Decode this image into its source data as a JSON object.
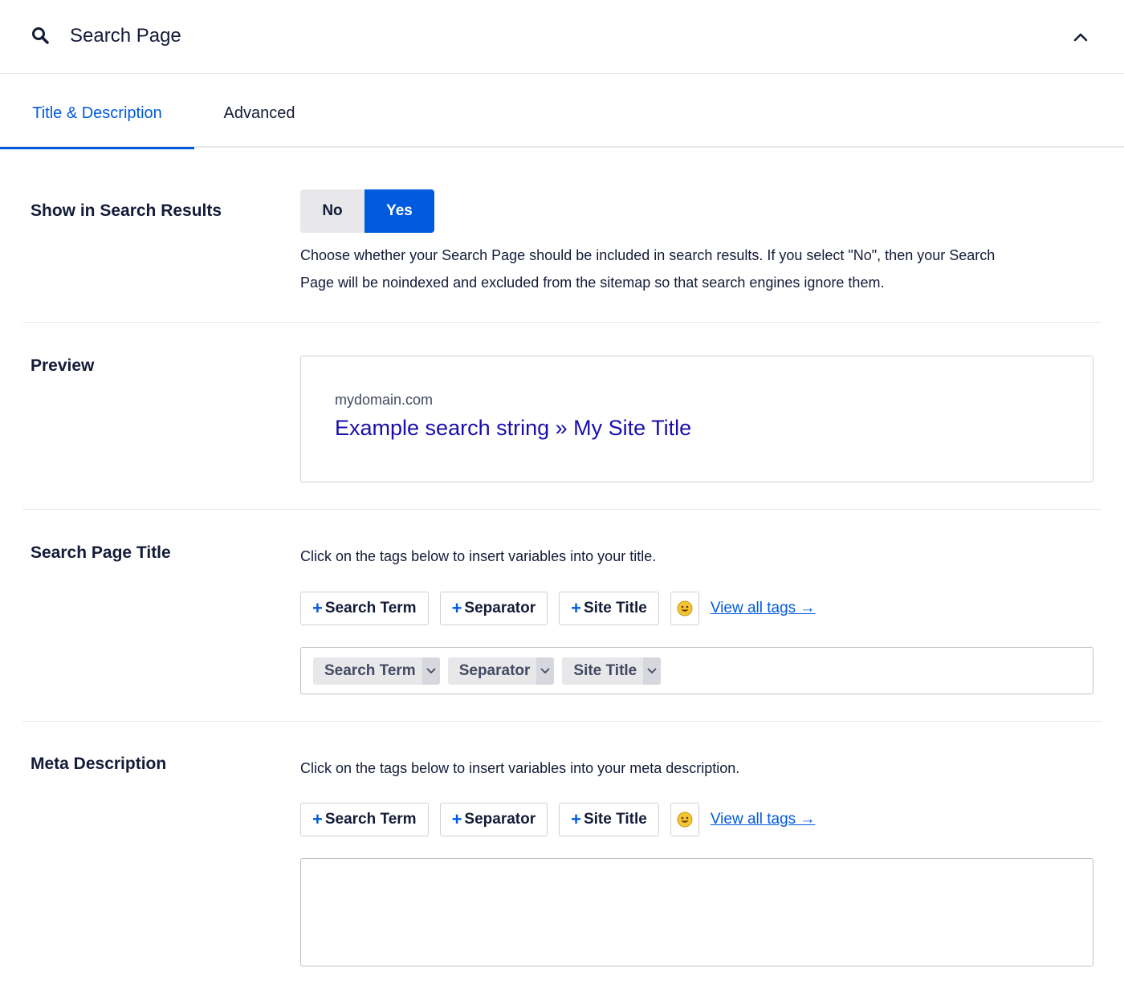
{
  "header": {
    "title": "Search Page",
    "icon": "search-icon",
    "toggle_icon": "chevron-up-icon"
  },
  "tabs": [
    {
      "label": "Title & Description",
      "active": true
    },
    {
      "label": "Advanced",
      "active": false
    }
  ],
  "colors": {
    "accent": "#005ae0",
    "text": "#141b38",
    "preview_link": "#1a0dab"
  },
  "show_in_search": {
    "label": "Show in Search Results",
    "options": [
      "No",
      "Yes"
    ],
    "selected": "Yes",
    "help_line1": "Choose whether your Search Page should be included in search results. If you select \"No\", then your Search",
    "help_line2": "Page will be noindexed and excluded from the sitemap so that search engines ignore them."
  },
  "preview": {
    "label": "Preview",
    "domain": "mydomain.com",
    "title": "Example search string » My Site Title"
  },
  "search_page_title": {
    "label": "Search Page Title",
    "help": "Click on the tags below to insert variables into your title.",
    "tags": [
      "Search Term",
      "Separator",
      "Site Title"
    ],
    "view_all": "View all tags →",
    "chips": [
      "Search Term",
      "Separator",
      "Site Title"
    ]
  },
  "meta_description": {
    "label": "Meta Description",
    "help": "Click on the tags below to insert variables into your meta description.",
    "tags": [
      "Search Term",
      "Separator",
      "Site Title"
    ],
    "view_all": "View all tags →",
    "value": ""
  }
}
